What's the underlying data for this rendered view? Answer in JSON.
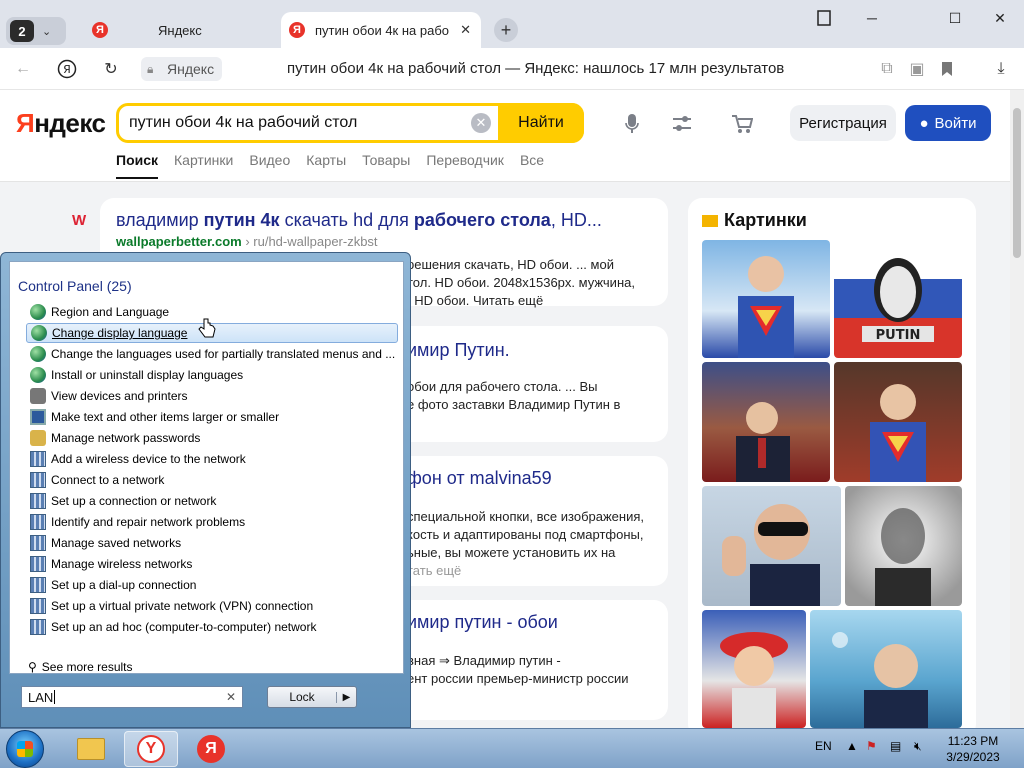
{
  "browser": {
    "tab_count": "2",
    "tabs": [
      {
        "title": "Яндекс",
        "active": false
      },
      {
        "title": "путин обои 4к на рабо",
        "active": true
      }
    ],
    "address": {
      "domain": "Яндекс",
      "title": "путин обои 4к на рабочий стол — Яндекс: нашлось 17 млн результатов"
    }
  },
  "yandex": {
    "logo_y": "Я",
    "logo_rest": "ндекс",
    "query": "путин обои 4к на рабочий стол",
    "search_button": "Найти",
    "register_button": "Регистрация",
    "login_button": "Войти",
    "nav": [
      "Поиск",
      "Картинки",
      "Видео",
      "Карты",
      "Товары",
      "Переводчик",
      "Все"
    ],
    "results": [
      {
        "title_html_parts": [
          "владимир ",
          "путин 4к",
          " скачать hd для ",
          "рабочего стола",
          ", HD..."
        ],
        "url_domain": "wallpaperbetter.com",
        "url_path": " › ru/hd-wallpaper-zkbst",
        "snippet_lines": [
          "решения скачать, HD обои. ... мой",
          "тол. HD обои. 2048x1536px. мужчина,",
          ", HD обои. Читать ещё"
        ]
      },
      {
        "title_tail": "имир Путин.",
        "snippet_lines": [
          "обои для рабочего стола. ... Вы",
          "е фото заставки Владимир Путин в"
        ]
      },
      {
        "title_tail": "фон от malvina59",
        "snippet_lines": [
          "специальной кнопки, все изображения,",
          "кость и адаптированы под смартфоны,",
          "ьные, вы можете установить их на",
          "тать ещё"
        ]
      },
      {
        "title_tail": "имир путин - обои",
        "snippet_lines": [
          "вная ⇒ Владимир путин -",
          "ент россии премьер-министр россии"
        ]
      }
    ],
    "images_title": "Картинки"
  },
  "start_menu": {
    "heading": "Control Panel (25)",
    "items": [
      {
        "label": "Region and Language",
        "icon": "globe-icon"
      },
      {
        "label": "Change display language",
        "icon": "globe-icon",
        "selected": true
      },
      {
        "label": "Change the languages used for partially translated menus and ...",
        "icon": "globe-icon"
      },
      {
        "label": "Install or uninstall display languages",
        "icon": "globe-icon"
      },
      {
        "label": "View devices and printers",
        "icon": "devices-icon"
      },
      {
        "label": "Make text and other items larger or smaller",
        "icon": "monitor-icon"
      },
      {
        "label": "Manage network passwords",
        "icon": "key-icon"
      },
      {
        "label": "Add a wireless device to the network",
        "icon": "network-icon"
      },
      {
        "label": "Connect to a network",
        "icon": "network-icon"
      },
      {
        "label": "Set up a connection or network",
        "icon": "network-icon"
      },
      {
        "label": "Identify and repair network problems",
        "icon": "network-icon"
      },
      {
        "label": "Manage saved networks",
        "icon": "network-icon"
      },
      {
        "label": "Manage wireless networks",
        "icon": "network-icon"
      },
      {
        "label": "Set up a dial-up connection",
        "icon": "network-icon"
      },
      {
        "label": "Set up a virtual private network (VPN) connection",
        "icon": "network-icon"
      },
      {
        "label": "Set up an ad hoc (computer-to-computer) network",
        "icon": "network-icon"
      }
    ],
    "see_more": "See more results",
    "search_value": "LAN",
    "lock_button": "Lock"
  },
  "taskbar": {
    "lang": "EN",
    "time": "11:23 PM",
    "date": "3/29/2023"
  }
}
